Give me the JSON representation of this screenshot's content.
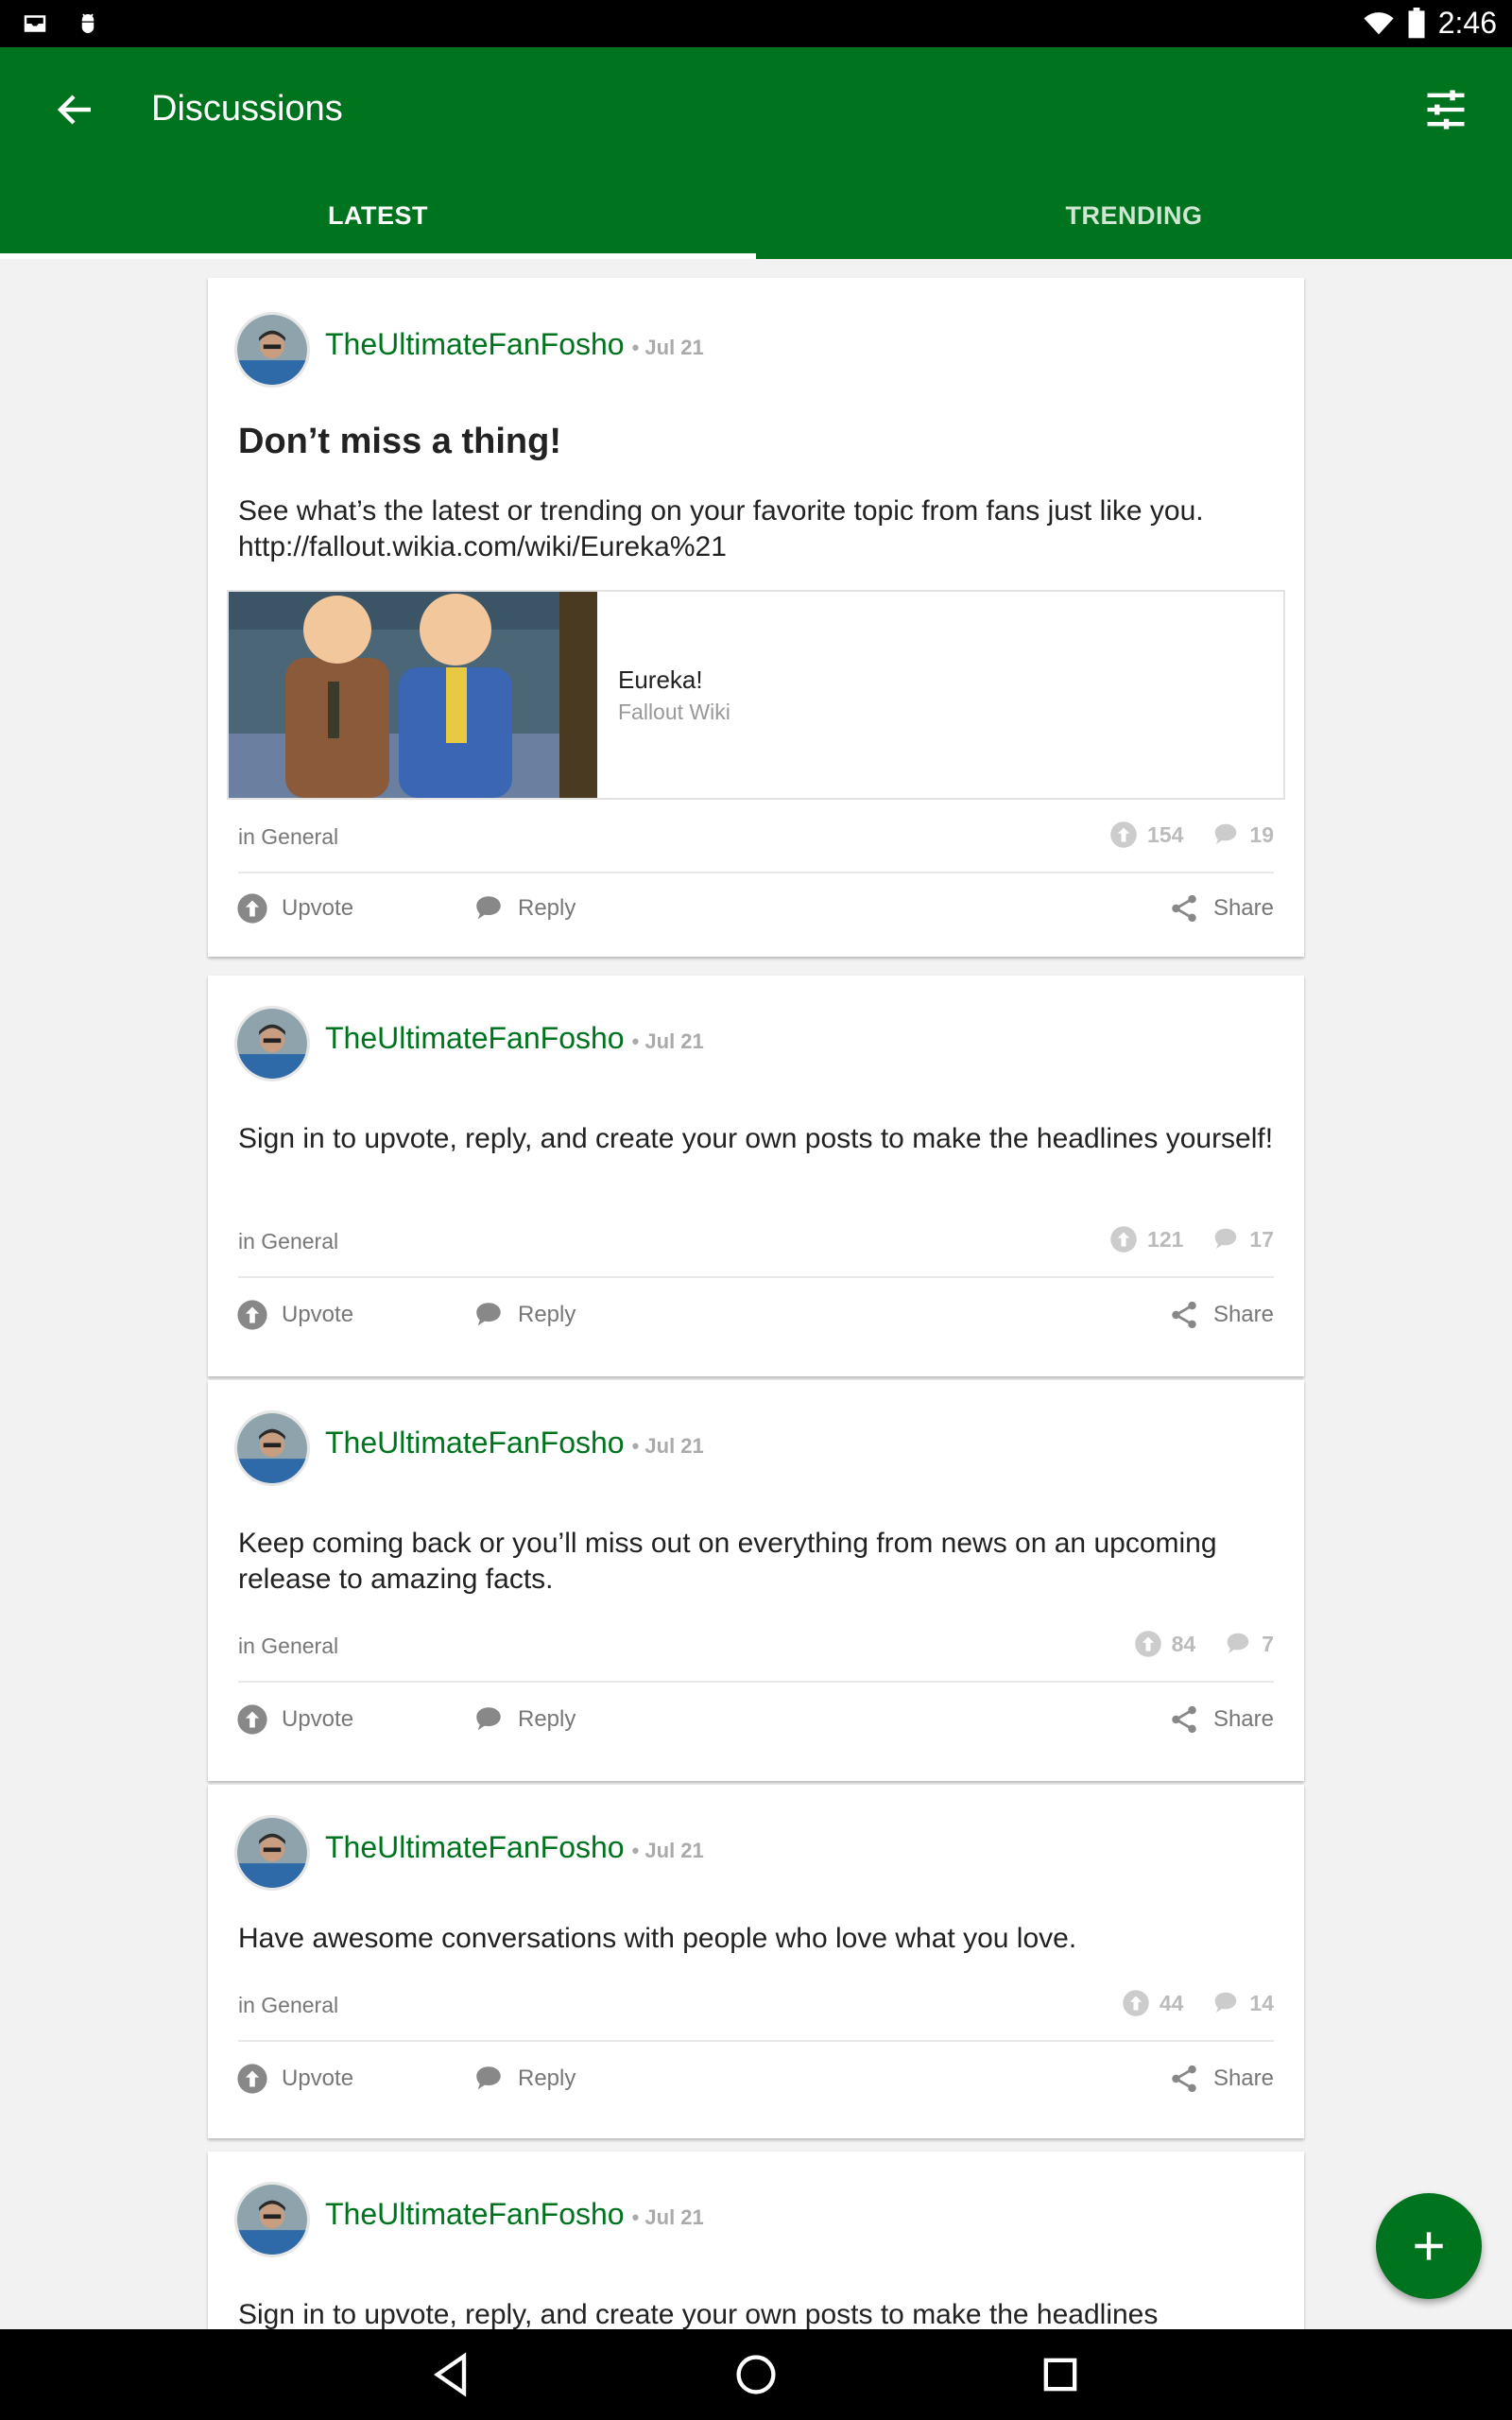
{
  "status_bar": {
    "time": "2:46"
  },
  "app_bar": {
    "title": "Discussions"
  },
  "tabs": [
    {
      "label": "LATEST",
      "selected": true
    },
    {
      "label": "TRENDING",
      "selected": false
    }
  ],
  "posts": [
    {
      "author": "TheUltimateFanFosho",
      "date": "• Jul 21",
      "title": "Don’t miss a thing!",
      "body": "See what’s the latest or trending on your favorite topic from fans just like you. http://fallout.wikia.com/wiki/Eureka%21",
      "link_preview": {
        "title": "Eureka!",
        "site": "Fallout Wiki"
      },
      "category": "in General",
      "upvotes": "154",
      "replies": "19"
    },
    {
      "author": "TheUltimateFanFosho",
      "date": "• Jul 21",
      "body": "Sign in to upvote, reply, and create your own posts to make the headlines yourself!",
      "category": "in General",
      "upvotes": "121",
      "replies": "17"
    },
    {
      "author": "TheUltimateFanFosho",
      "date": "• Jul 21",
      "body": "Keep coming back or you’ll miss out on everything from news on an upcoming release to amazing facts.",
      "category": "in General",
      "upvotes": "84",
      "replies": "7"
    },
    {
      "author": "TheUltimateFanFosho",
      "date": "• Jul 21",
      "body": "Have awesome conversations with people who love what you love.",
      "category": "in General",
      "upvotes": "44",
      "replies": "14"
    },
    {
      "author": "TheUltimateFanFosho",
      "date": "• Jul 21",
      "body": "Sign in to upvote, reply, and create your own posts to make the headlines"
    }
  ],
  "actions": {
    "upvote": "Upvote",
    "reply": "Reply",
    "share": "Share"
  },
  "colors": {
    "brand_green": "#00731f",
    "status_black": "#000000",
    "feed_background": "#f2f2f2"
  },
  "icons": {
    "app_bar": [
      "back-arrow-icon",
      "filter-sliders-icon"
    ],
    "status_bar": [
      "inbox-icon",
      "android-debug-icon",
      "wifi-icon",
      "battery-icon"
    ],
    "post": [
      "avatar",
      "upvote-icon",
      "reply-icon",
      "share-icon"
    ],
    "fab": "plus-icon",
    "nav_bar": [
      "back-triangle-icon",
      "home-circle-icon",
      "recents-square-icon"
    ]
  }
}
